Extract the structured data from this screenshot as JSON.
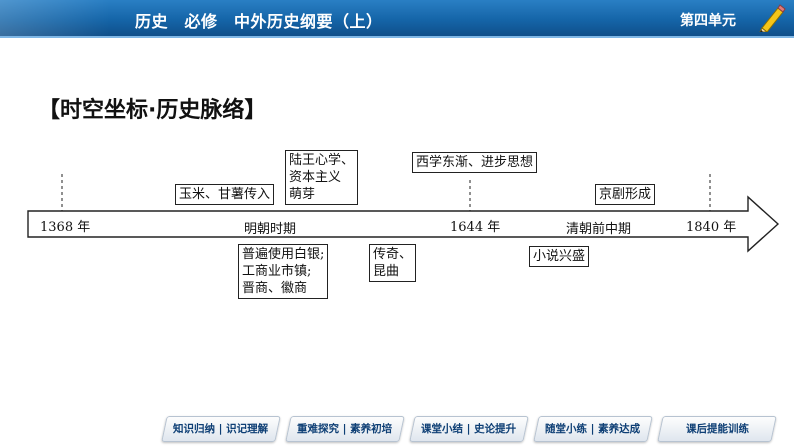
{
  "header": {
    "title": "历史　必修　中外历史纲要（上）",
    "unit": "第四单元"
  },
  "section_heading": "【时空坐标·历史脉络】",
  "timeline": {
    "years": {
      "start": "1368 年",
      "mid": "1644 年",
      "end": "1840 年"
    },
    "periods": {
      "ming": "明朝时期",
      "qing": "清朝前中期"
    },
    "events_above": {
      "corn": "玉米、甘薯传入",
      "lu_wang_1": "陆王心学、",
      "lu_wang_2": "资本主义",
      "lu_wang_3": "萌芽",
      "west": "西学东渐、进步思想",
      "opera": "京剧形成"
    },
    "events_below": {
      "silver_1": "普遍使用白银;",
      "silver_2": "工商业市镇;",
      "silver_3": "晋商、徽商",
      "drama_1": "传奇、",
      "drama_2": "昆曲",
      "novel": "小说兴盛"
    }
  },
  "footer_nav": [
    "知识归纳 | 识记理解",
    "重难探究 | 素养初培",
    "课堂小结 | 史论提升",
    "随堂小练 | 素养达成",
    "课后提能训练"
  ]
}
